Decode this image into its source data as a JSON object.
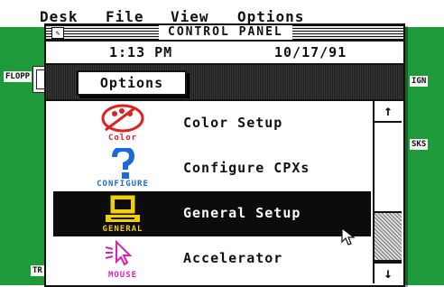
{
  "menubar": {
    "items": [
      "Desk",
      "File",
      "View",
      "Options"
    ]
  },
  "desktop": {
    "labels": {
      "floppy": "FLOPP",
      "sign": "IGN",
      "disks": "SKS",
      "trash": "TR"
    }
  },
  "window": {
    "title": "CONTROL PANEL",
    "time": "1:13 PM",
    "date": "10/17/91",
    "options_label": "Options"
  },
  "list": {
    "selected_index": 2,
    "items": [
      {
        "caption": "Color",
        "label": "Color Setup",
        "icon": "palette-icon",
        "caption_color": "#e02020"
      },
      {
        "caption": "CONFIGURE",
        "label": "Configure CPXs",
        "icon": "question-mark-icon",
        "caption_color": "#1a6ad8"
      },
      {
        "caption": "GENERAL",
        "label": "General Setup",
        "icon": "computer-icon",
        "caption_color": "#f0d000"
      },
      {
        "caption": "MOUSE",
        "label": "Accelerator",
        "icon": "mouse-cursor-icon",
        "caption_color": "#e020b0"
      }
    ]
  },
  "scrollbar": {
    "up": "↑",
    "down": "↓"
  }
}
